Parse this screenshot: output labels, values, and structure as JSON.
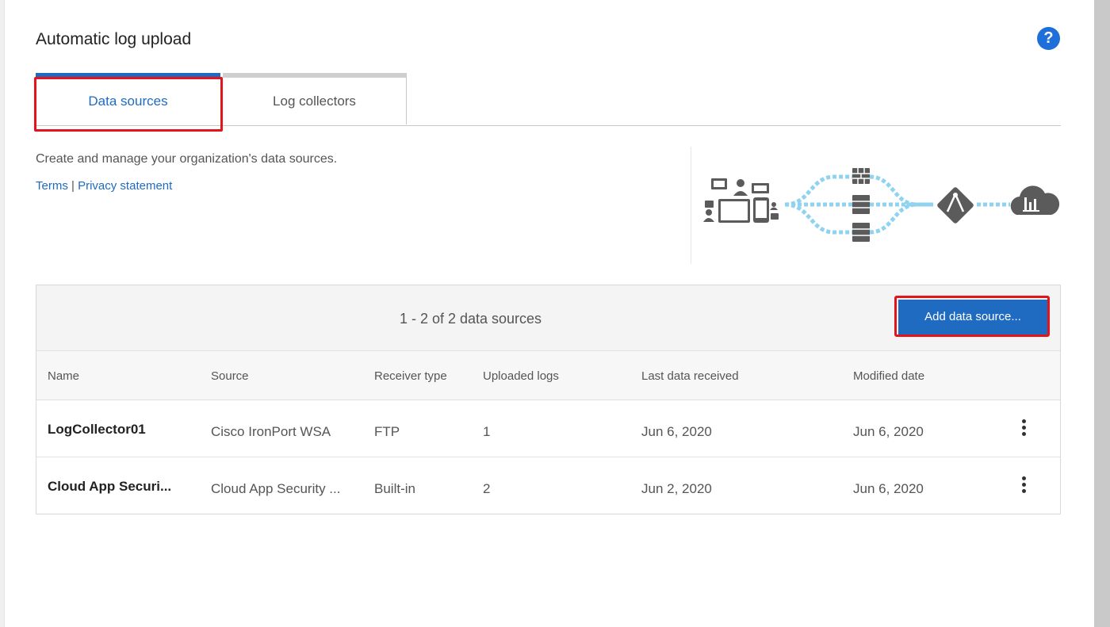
{
  "page": {
    "title": "Automatic log upload",
    "help_label": "?"
  },
  "tabs": [
    {
      "label": "Data sources",
      "active": true
    },
    {
      "label": "Log collectors",
      "active": false
    }
  ],
  "intro": {
    "description": "Create and manage your organization's data sources.",
    "terms_link": "Terms",
    "separator": "|",
    "privacy_link": "Privacy statement"
  },
  "table": {
    "count_text": "1 - 2 of 2 data sources",
    "add_button": "Add data source...",
    "columns": [
      "Name",
      "Source",
      "Receiver type",
      "Uploaded logs",
      "Last data received",
      "Modified date"
    ],
    "rows": [
      {
        "name": "LogCollector01",
        "source": "Cisco IronPort WSA",
        "receiver": "FTP",
        "uploaded": "1",
        "last_received": "Jun 6, 2020",
        "modified": "Jun 6, 2020"
      },
      {
        "name": "Cloud App Securi...",
        "source": "Cloud App Security ...",
        "receiver": "Built-in",
        "uploaded": "2",
        "last_received": "Jun 2, 2020",
        "modified": "Jun 6, 2020"
      }
    ]
  },
  "colors": {
    "accent": "#1f6bc1",
    "highlight": "#e2141c",
    "help": "#1e6fd9"
  },
  "icons": [
    "help-icon",
    "devices-icon",
    "firewall-icon",
    "server-icon",
    "collector-icon",
    "cloud-analytics-icon",
    "more-actions-icon"
  ]
}
